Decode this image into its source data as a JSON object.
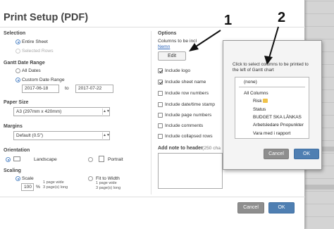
{
  "dialog": {
    "title": "Print Setup (PDF)"
  },
  "selection": {
    "heading": "Selection",
    "entire_sheet": "Entire Sheet",
    "selected_rows": "Selected Rows"
  },
  "gantt": {
    "heading": "Gantt Date Range",
    "all_dates": "All Dates",
    "custom": "Custom Date Range",
    "from": "2017-06-18",
    "to_label": "to",
    "to": "2017-07-22"
  },
  "paper": {
    "heading": "Paper Size",
    "value": "A3 (297mm x 420mm)"
  },
  "margins": {
    "heading": "Margins",
    "value": "Default (0.5\")"
  },
  "orientation": {
    "heading": "Orientation",
    "landscape": "Landscape",
    "portrait": "Portrait"
  },
  "scaling": {
    "heading": "Scaling",
    "scale": "Scale",
    "percent": "100",
    "percent_sign": "%",
    "page_wide": "1 page wide",
    "pages_long": "3 page(s) long",
    "fit": "Fit to Width",
    "fit_wide": "1 page wide",
    "fit_long": "3 page(s) long"
  },
  "options": {
    "heading": "Options",
    "columns_label": "Columns to be incl",
    "columns_value": "Nemn",
    "edit": "Edit",
    "items": [
      {
        "label": "Include logo",
        "checked": true
      },
      {
        "label": "Include sheet name",
        "checked": true
      },
      {
        "label": "Include row numbers",
        "checked": false
      },
      {
        "label": "Include date/time stamp",
        "checked": false
      },
      {
        "label": "Include page numbers",
        "checked": false
      },
      {
        "label": "Include comments",
        "checked": false
      },
      {
        "label": "Include collapsed rows",
        "checked": false
      }
    ],
    "note_label": "Add note to header",
    "note_hint": "(250 cha"
  },
  "footer": {
    "cancel": "Cancel",
    "ok": "OK"
  },
  "popup": {
    "instruction": "Click to select columns to be printed to the left of Gantt chart",
    "items": [
      "(none)",
      "All Columns",
      "Risk",
      "Status",
      "BUDGET SKA LÄNKAS",
      "Arbetsledare Pnopunkter",
      "Vara med i rapport"
    ],
    "cancel": "Cancel",
    "ok": "OK"
  },
  "annotations": {
    "one": "1",
    "two": "2"
  }
}
